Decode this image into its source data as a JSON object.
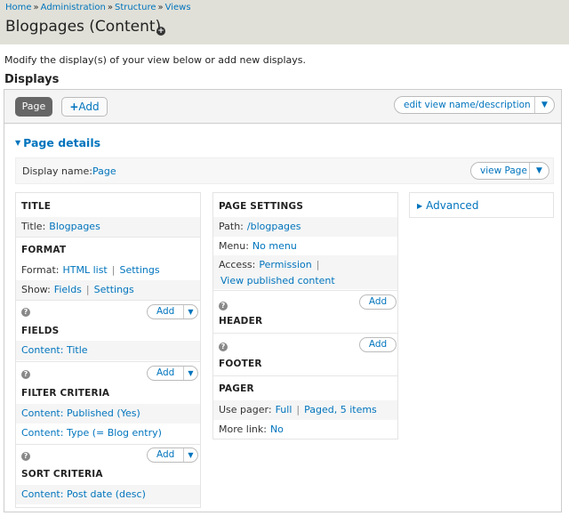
{
  "breadcrumb": [
    "Home",
    "Administration",
    "Structure",
    "Views"
  ],
  "breadcrumb_sep": "»",
  "page_title": "Blogpages (Content)",
  "title_plus_icon": "+",
  "intro": "Modify the display(s) of your view below or add new displays.",
  "displays_heading": "Displays",
  "tabs": {
    "page_label": "Page",
    "add_label": "Add",
    "add_icon": "+"
  },
  "edit_name_button": "edit view name/description",
  "page_details_label": "Page details",
  "display_name": {
    "label": "Display name:",
    "value": "Page",
    "view_button": "view Page"
  },
  "col1": {
    "title": {
      "heading": "TITLE",
      "label": "Title:",
      "value": "Blogpages"
    },
    "format": {
      "heading": "FORMAT",
      "format_label": "Format:",
      "format_value": "HTML list",
      "format_settings": "Settings",
      "show_label": "Show:",
      "show_value": "Fields",
      "show_settings": "Settings"
    },
    "fields": {
      "heading": "FIELDS",
      "add": "Add",
      "items": [
        "Content: Title"
      ]
    },
    "filter": {
      "heading": "FILTER CRITERIA",
      "add": "Add",
      "items": [
        "Content: Published (Yes)",
        "Content: Type (= Blog entry)"
      ]
    },
    "sort": {
      "heading": "SORT CRITERIA",
      "add": "Add",
      "items": [
        "Content: Post date (desc)"
      ]
    }
  },
  "col2": {
    "page_settings": {
      "heading": "PAGE SETTINGS",
      "path_label": "Path:",
      "path_value": "/blogpages",
      "menu_label": "Menu:",
      "menu_value": "No menu",
      "access_label": "Access:",
      "access_value": "Permission",
      "view_published": "View published content"
    },
    "header": {
      "heading": "HEADER",
      "add": "Add"
    },
    "footer": {
      "heading": "FOOTER",
      "add": "Add"
    },
    "pager": {
      "heading": "PAGER",
      "use_label": "Use pager:",
      "use_value": "Full",
      "use_value2": "Paged, 5 items",
      "more_label": "More link:",
      "more_value": "No"
    }
  },
  "col3": {
    "advanced_label": "Advanced"
  },
  "colors": {
    "link": "#0074bd",
    "header_bg": "#e0e0d8",
    "active_tab": "#666666"
  }
}
